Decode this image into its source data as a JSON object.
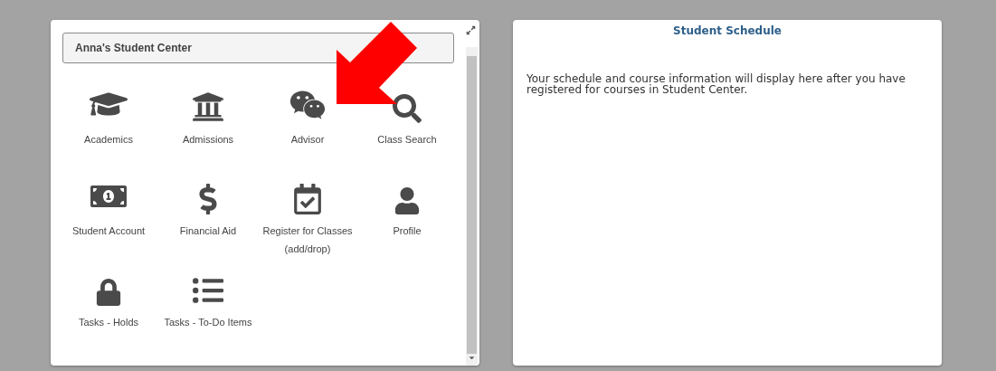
{
  "student_center": {
    "title": "Anna's Student Center",
    "tiles": [
      {
        "label": "Academics"
      },
      {
        "label": "Admissions"
      },
      {
        "label": "Advisor"
      },
      {
        "label": "Class Search"
      },
      {
        "label": "Student Account"
      },
      {
        "label": "Financial Aid"
      },
      {
        "label": "Register for Classes (add/drop)"
      },
      {
        "label": "Profile"
      },
      {
        "label": "Tasks - Holds"
      },
      {
        "label": "Tasks - To-Do Items"
      }
    ]
  },
  "student_schedule": {
    "title": "Student Schedule",
    "message": "Your schedule and course information will display here after you have registered for courses in Student Center."
  }
}
